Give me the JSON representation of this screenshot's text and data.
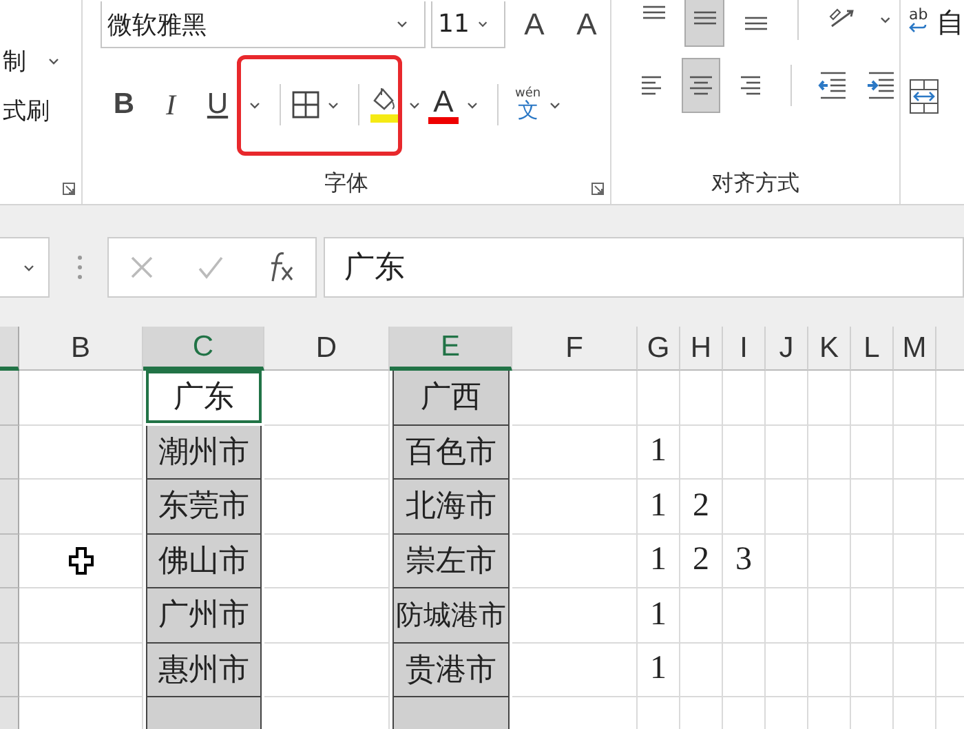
{
  "ribbon": {
    "clipboard": {
      "items": [
        {
          "label": "制",
          "dropdown": true
        },
        {
          "label": "式刷",
          "dropdown": false
        }
      ]
    },
    "font": {
      "font_name": "微软雅黑",
      "font_size": "11",
      "grow": "A",
      "shrink": "A",
      "bold": "B",
      "italic": "I",
      "underline": "U",
      "font_color": "A",
      "phonetic_top": "wén",
      "phonetic": "文",
      "label": "字体"
    },
    "alignment": {
      "buttons": [
        {
          "kind": "top",
          "selected": false
        },
        {
          "kind": "middle",
          "selected": true
        },
        {
          "kind": "bottom",
          "selected": false
        },
        {
          "kind": "orientation",
          "selected": false
        },
        {
          "kind": "left",
          "selected": false
        },
        {
          "kind": "center",
          "selected": true
        },
        {
          "kind": "right",
          "selected": false
        },
        {
          "kind": "outdent",
          "selected": false
        },
        {
          "kind": "indent",
          "selected": false
        }
      ],
      "label": "对齐方式"
    },
    "wrap": {
      "icon_text": "ab",
      "label": "自"
    }
  },
  "formula_bar": {
    "value": "广东"
  },
  "columns": [
    {
      "label": "B",
      "selected": false
    },
    {
      "label": "C",
      "selected": true
    },
    {
      "label": "D",
      "selected": false
    },
    {
      "label": "E",
      "selected": true
    },
    {
      "label": "F",
      "selected": false
    },
    {
      "label": "G",
      "selected": false
    },
    {
      "label": "H",
      "selected": false
    },
    {
      "label": "I",
      "selected": false
    },
    {
      "label": "J",
      "selected": false
    },
    {
      "label": "K",
      "selected": false
    },
    {
      "label": "L",
      "selected": false
    },
    {
      "label": "M",
      "selected": false
    }
  ],
  "rows": [
    {
      "column_c": {
        "text": "广东",
        "kind": "active"
      },
      "column_e": {
        "text": "广西",
        "kind": "filled"
      }
    },
    {
      "column_c": {
        "text": "潮州市",
        "kind": "filled"
      },
      "column_e": {
        "text": "百色市",
        "kind": "filled"
      },
      "column_g": {
        "text": "1",
        "kind": "number"
      }
    },
    {
      "column_c": {
        "text": "东莞市",
        "kind": "filled"
      },
      "column_e": {
        "text": "北海市",
        "kind": "filled"
      },
      "column_g": {
        "text": "1",
        "kind": "number"
      },
      "column_h": {
        "text": "2",
        "kind": "number"
      }
    },
    {
      "column_b": {
        "kind": "cursor"
      },
      "column_c": {
        "text": "佛山市",
        "kind": "filled"
      },
      "column_e": {
        "text": "崇左市",
        "kind": "filled"
      },
      "column_g": {
        "text": "1",
        "kind": "number"
      },
      "column_h": {
        "text": "2",
        "kind": "number"
      },
      "column_i": {
        "text": "3",
        "kind": "number"
      }
    },
    {
      "column_c": {
        "text": "广州市",
        "kind": "filled"
      },
      "column_e": {
        "text": "防城港市",
        "kind": "filled"
      },
      "column_g": {
        "text": "1",
        "kind": "number"
      }
    },
    {
      "column_c": {
        "text": "惠州市",
        "kind": "filled"
      },
      "column_e": {
        "text": "贵港市",
        "kind": "filled"
      },
      "column_g": {
        "text": "1",
        "kind": "number"
      }
    },
    {
      "column_c": {
        "kind": "filled"
      },
      "column_e": {
        "kind": "filled"
      }
    }
  ]
}
